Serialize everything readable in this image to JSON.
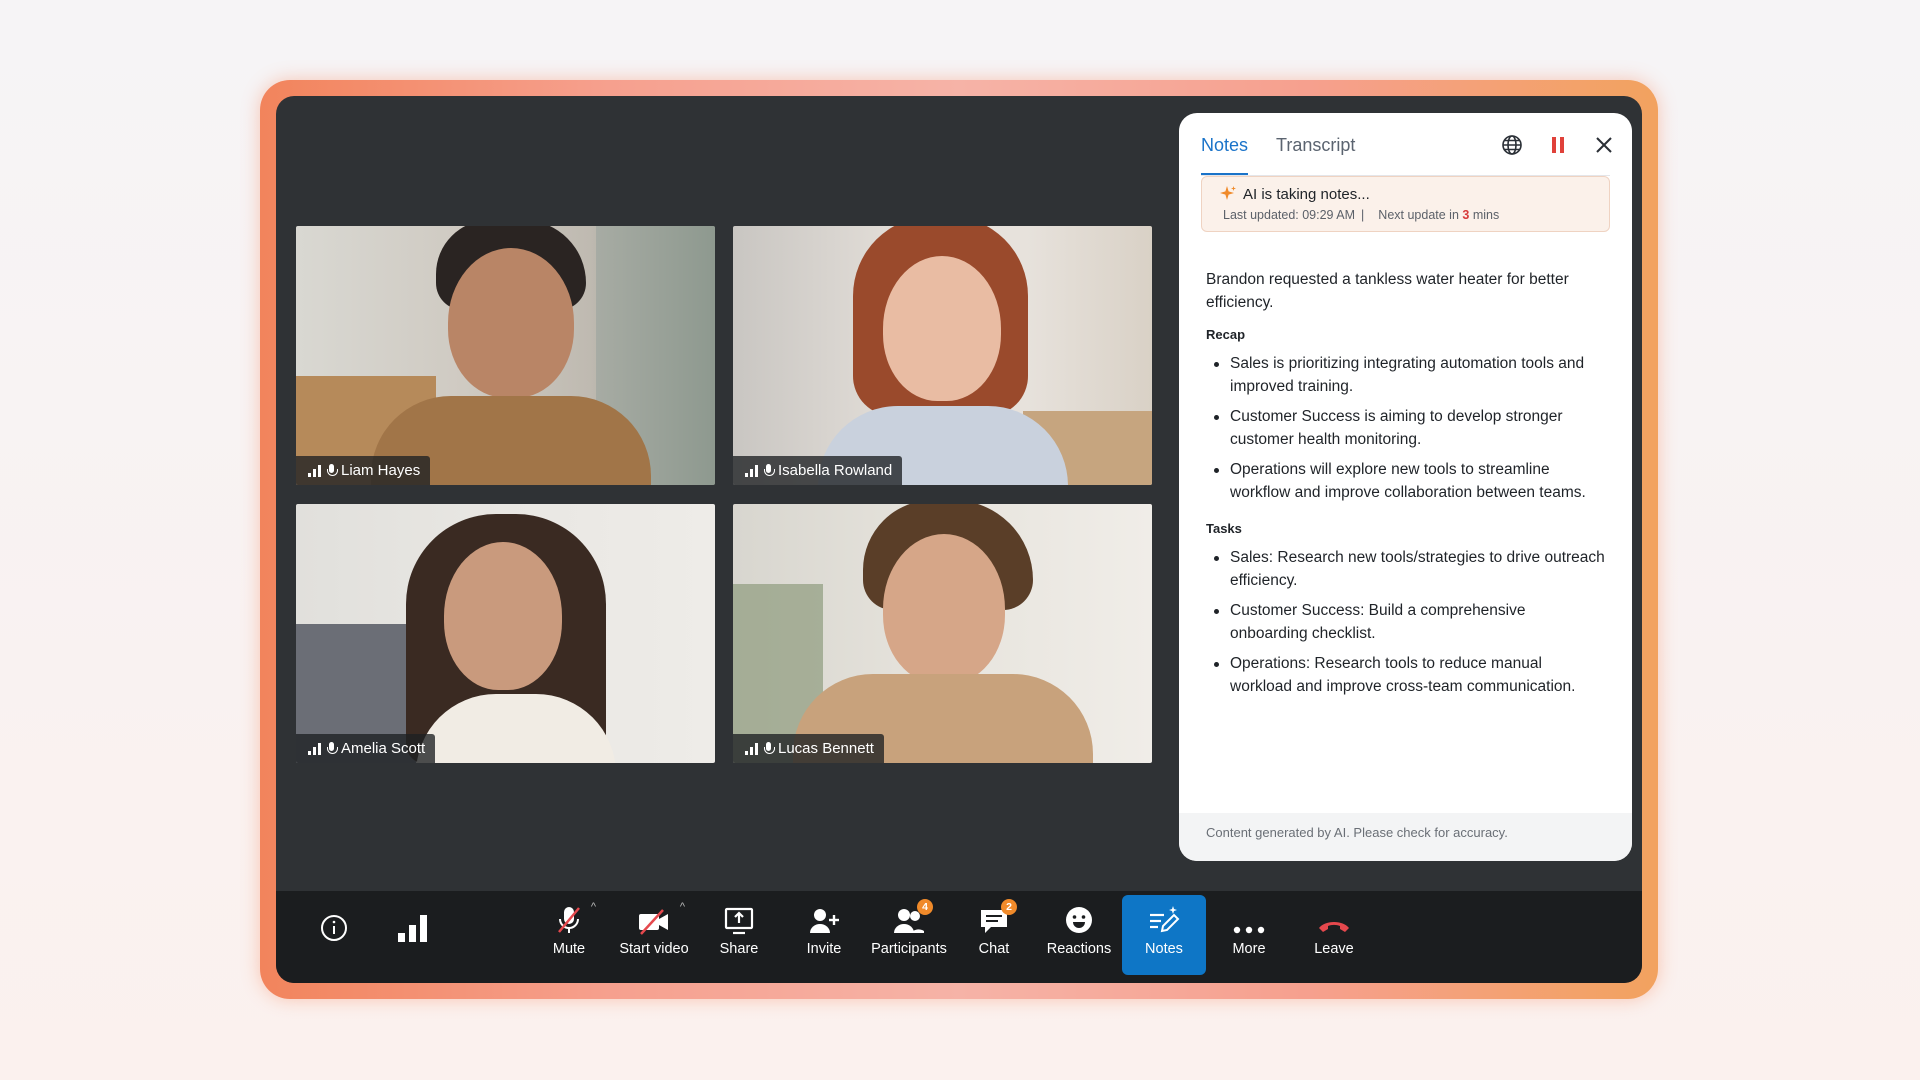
{
  "participants": [
    {
      "name": "Liam Hayes"
    },
    {
      "name": "Isabella Rowland"
    },
    {
      "name": "Amelia Scott"
    },
    {
      "name": "Lucas Bennett"
    }
  ],
  "panel": {
    "tabs": [
      {
        "label": "Notes",
        "active": true
      },
      {
        "label": "Transcript",
        "active": false
      }
    ],
    "icons": [
      "globe-icon",
      "pause-icon",
      "close-icon"
    ],
    "ai_status": {
      "title": "AI is taking notes...",
      "last_updated": "Last updated: 09:29 AM",
      "separator": "|",
      "next_update_prefix": "Next update in",
      "next_update_value": "3",
      "next_update_suffix": "mins"
    },
    "intro": "Brandon requested a tankless water heater for better efficiency.",
    "recap_title": "Recap",
    "recap": [
      "Sales is prioritizing integrating automation tools and improved training.",
      "Customer Success is aiming to develop stronger customer health monitoring.",
      "Operations will explore new tools to streamline workflow and improve collaboration between teams."
    ],
    "tasks_title": "Tasks",
    "tasks": [
      "Sales: Research new tools/strategies to drive outreach efficiency.",
      "Customer Success: Build a comprehensive onboarding checklist.",
      "Operations: Research tools to reduce manual workload and improve cross-team communication."
    ],
    "disclaimer": "Content generated by AI. Please check for accuracy."
  },
  "toolbar": {
    "mute": "Mute",
    "start_video": "Start video",
    "share": "Share",
    "invite": "Invite",
    "participants": "Participants",
    "participants_count": "4",
    "chat": "Chat",
    "chat_count": "2",
    "reactions": "Reactions",
    "notes": "Notes",
    "more": "More",
    "leave": "Leave"
  },
  "colors": {
    "accent": "#0e76c6",
    "tab_active": "#1a73c9",
    "badge": "#f08a2a",
    "leave": "#e5484d",
    "pause": "#e0413a"
  }
}
